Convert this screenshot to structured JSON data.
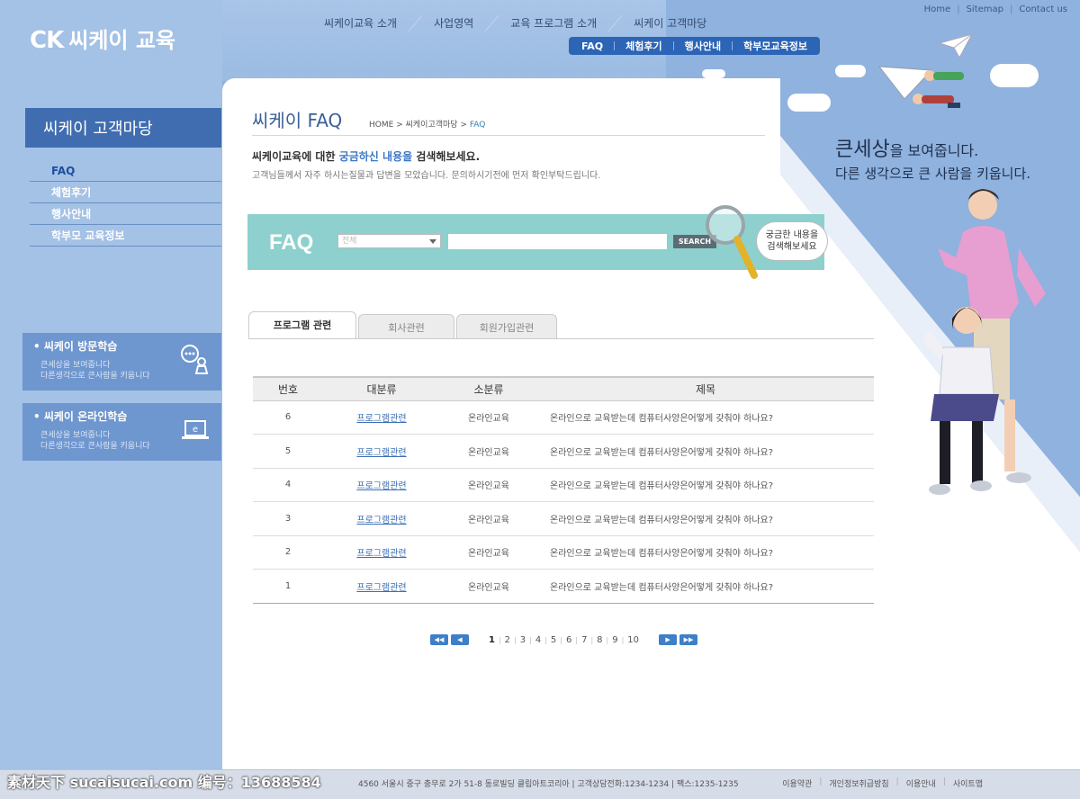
{
  "header": {
    "logo_ck": "CK",
    "logo_name": "씨케이 교육",
    "gnb": [
      "씨케이교육 소개",
      "사업영역",
      "교육 프로그램 소개",
      "씨케이 고객마당"
    ],
    "subnav": [
      "FAQ",
      "체험후기",
      "행사안내",
      "학부모교육정보"
    ],
    "util": [
      "Home",
      "Sitemap",
      "Contact us"
    ]
  },
  "sidebar": {
    "title": "씨케이 고객마당",
    "items": [
      "FAQ",
      "체험후기",
      "행사안내",
      "학부모 교육정보"
    ],
    "box1": {
      "title": "• 씨케이 방문학습",
      "line1": "큰세상을 보여줍니다",
      "line2": "다른생각으로 큰사람을 키웁니다"
    },
    "box2": {
      "title": "• 씨케이 온라인학습",
      "line1": "큰세상을 보여줍니다",
      "line2": "다른생각으로 큰사람을 키웁니다"
    }
  },
  "content": {
    "title": "씨케이 FAQ",
    "breadcrumb": [
      "HOME",
      "씨케이고객마당",
      "FAQ"
    ],
    "intro_pre": "씨케이교육에 대한 ",
    "intro_hl": "궁금하신 내용을",
    "intro_post": " 검색해보세요.",
    "intro_sub": "고객님들께서 자주 하시는질물과 답변을 모았습니다. 문의하시기전에 먼저 확인부탁드립니다."
  },
  "search": {
    "label": "FAQ",
    "select_value": "전체",
    "button": "SEARCH",
    "bubble_line1": "궁금한 내용을",
    "bubble_line2": "검색해보세요"
  },
  "tabs": [
    "프로그램 관련",
    "회사관련",
    "회원가입관련"
  ],
  "table": {
    "headers": [
      "번호",
      "대분류",
      "소분류",
      "제목"
    ],
    "rows": [
      {
        "no": "6",
        "cat": "프로그램관련",
        "sub": "온라인교육",
        "subject": "온라인으로 교육받는데 컴퓨터사양은어떻게 갖춰야 하나요?"
      },
      {
        "no": "5",
        "cat": "프로그램관련",
        "sub": "온라인교육",
        "subject": "온라인으로 교육받는데 컴퓨터사양은어떻게 갖춰야 하나요?"
      },
      {
        "no": "4",
        "cat": "프로그램관련",
        "sub": "온라인교육",
        "subject": "온라인으로 교육받는데 컴퓨터사양은어떻게 갖춰야 하나요?"
      },
      {
        "no": "3",
        "cat": "프로그램관련",
        "sub": "온라인교육",
        "subject": "온라인으로 교육받는데 컴퓨터사양은어떻게 갖춰야 하나요?"
      },
      {
        "no": "2",
        "cat": "프로그램관련",
        "sub": "온라인교육",
        "subject": "온라인으로 교육받는데 컴퓨터사양은어떻게 갖춰야 하나요?"
      },
      {
        "no": "1",
        "cat": "프로그램관련",
        "sub": "온라인교육",
        "subject": "온라인으로 교육받는데 컴퓨터사양은어떻게 갖춰야 하나요?"
      }
    ]
  },
  "pager": {
    "first": "◀◀",
    "prev": "◀",
    "next": "▶",
    "last": "▶▶",
    "pages": [
      "1",
      "2",
      "3",
      "4",
      "5",
      "6",
      "7",
      "8",
      "9",
      "10"
    ],
    "current": "1"
  },
  "promo": {
    "slogan_big": "큰세상",
    "slogan_rest": "을 보여줍니다.",
    "slogan_line2": "다른 생각으로 큰 사람을 키웁니다."
  },
  "footer": {
    "address": "4560 서울시 중구 충무로 2가 51-8 동로빌딩 클립아트코리아 | 고객상담전화:1234-1234 | 팩스:1235-1235",
    "links": [
      "이용약관",
      "개인정보취급방침",
      "이용안내",
      "사이트맵"
    ],
    "watermark": "素材天下 sucaisucai.com  编号：13688584"
  },
  "colors": {
    "accent": "#3f6db0",
    "search_bg": "#8ed0ce",
    "subnav_bg": "#2c64b6",
    "link": "#3b6fb4"
  }
}
